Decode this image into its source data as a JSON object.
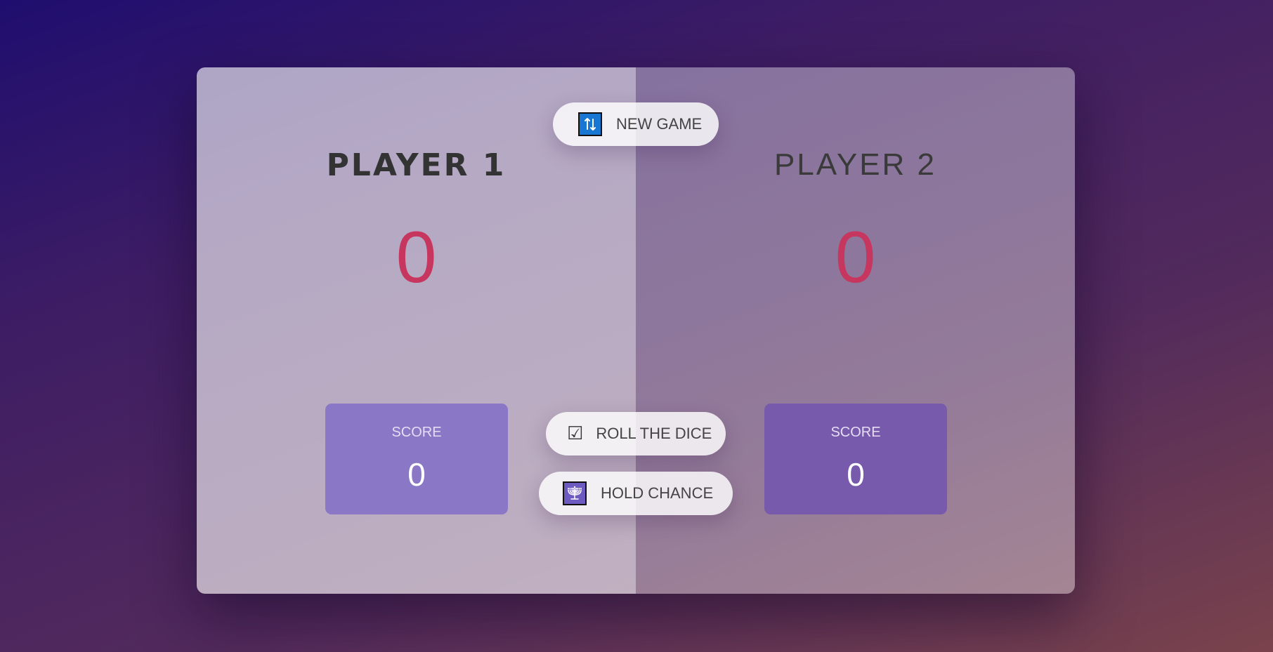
{
  "players": [
    {
      "name": "PLAYER 1",
      "total_score": "0",
      "current_label": "SCORE",
      "current_score": "0",
      "active": true
    },
    {
      "name": "PLAYER 2",
      "total_score": "0",
      "current_label": "SCORE",
      "current_score": "0",
      "active": false
    }
  ],
  "buttons": {
    "new_game": {
      "label": "NEW GAME",
      "icon": "refresh-icon"
    },
    "roll": {
      "label": "ROLL THE DICE",
      "icon": "checkbox-icon"
    },
    "hold": {
      "label": "HOLD CHANCE",
      "icon": "menorah-icon"
    }
  },
  "colors": {
    "score": "#c7365f",
    "current_box_p1": "#8a77c5",
    "current_box_p2": "#775aab",
    "refresh_icon_bg": "#1877d2"
  }
}
